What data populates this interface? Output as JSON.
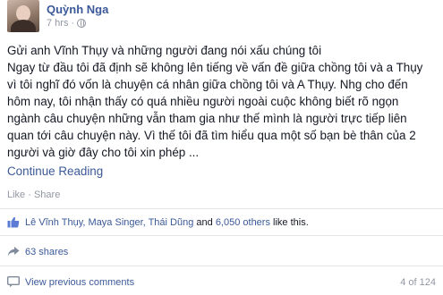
{
  "post": {
    "author": "Quỳnh Nga",
    "time": "7 hrs",
    "lines": [
      "Gửi anh Vĩnh Thụy và những người đang nói xấu chúng tôi",
      "Ngay từ đầu tôi đã định sẽ không lên tiếng về vấn đề giữa chồng tôi và a Thụy",
      "vì tôi nghĩ đó vốn là chuyện cá nhân giữa chồng tôi và A Thụy. Nhg cho đến",
      "hôm nay, tôi nhận thấy có quá nhiều người ngoài cuộc không biết rõ ngọn",
      "ngành câu chuyện những vẫn tham gia như thế mình là người trực tiếp liên",
      "quan tới câu chuyện này. Vì thế tôi đã tìm hiểu qua một số bạn bè thân của 2",
      "người và giờ đây cho tôi xin phép ..."
    ],
    "continue_label": "Continue Reading"
  },
  "actions": {
    "like_label": "Like",
    "separator": " · ",
    "share_label": "Share"
  },
  "likes": {
    "names": "Lê Vĩnh Thụy, Maya Singer, Thái Dũng",
    "connector": " and ",
    "others": "6,050 others",
    "suffix": " like this."
  },
  "shares": {
    "label": "63 shares"
  },
  "comments": {
    "view_label": "View previous comments",
    "pager": "4 of 124"
  },
  "icons": {
    "like": "thumbs-up-icon",
    "share": "share-arrow-icon",
    "comment": "comment-bubble-icon",
    "privacy": "globe-icon"
  },
  "colors": {
    "link": "#3b5998",
    "muted": "#9197a3",
    "text": "#141823"
  }
}
